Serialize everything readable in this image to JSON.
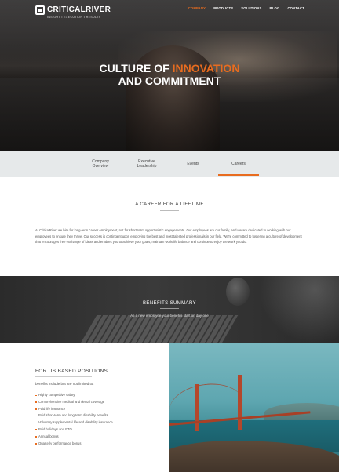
{
  "brand": {
    "name": "CRITICALRIVER",
    "tagline": "INSIGHT • EXECUTION • RESULTS"
  },
  "nav": {
    "items": [
      {
        "label": "COMPANY",
        "active": true
      },
      {
        "label": "PRODUCTS",
        "active": false
      },
      {
        "label": "SOLUTIONS",
        "active": false
      },
      {
        "label": "BLOG",
        "active": false
      },
      {
        "label": "CONTACT",
        "active": false
      }
    ]
  },
  "hero": {
    "line1_prefix": "CULTURE OF ",
    "line1_highlight": "INNOVATION",
    "line2": "AND COMMITMENT"
  },
  "tabs": [
    {
      "label": "Company Overview"
    },
    {
      "label": "Executive Leadership"
    },
    {
      "label": "Events"
    },
    {
      "label": "Careers",
      "active": true
    }
  ],
  "career": {
    "heading": "A CAREER FOR A LIFETIME",
    "body": "At CriticalRiver we hire for long-term career employment, not for short-term opportunistic engagements. Our employees are our family, and we are dedicated to working with our employees to ensure they thrive. Our success is contingent upon employing the best and most talented professionals in our field. We're committed to fostering a culture of development that encourages free exchange of ideas and enables you to achieve your goals, maintain work/life balance and continue to enjoy the work you do."
  },
  "benefits": {
    "heading": "BENEFITS SUMMARY",
    "subtitle": "As a new employee your benefits start on day one"
  },
  "us_positions": {
    "title": "FOR US BASED POSITIONS",
    "intro": "benefits include but are not limited to:",
    "items": [
      "Highly competitive salary",
      "Comprehensive medical and dental coverage",
      "Paid life insurance",
      "Paid short-term and long-term disability benefits",
      "Voluntary supplemental life and disability insurance",
      "Paid holidays and PTO",
      "Annual bonus",
      "Quarterly performance bonus"
    ]
  },
  "colors": {
    "accent": "#e86c1f",
    "tabs_bg": "#e6e9ea"
  }
}
